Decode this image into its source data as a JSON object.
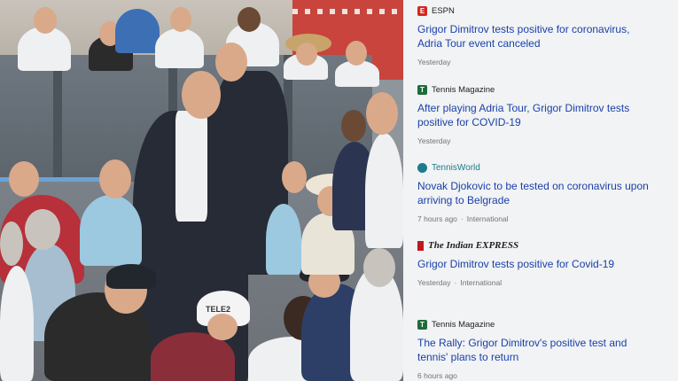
{
  "news": {
    "items": [
      {
        "source": "ESPN",
        "source_logo": "espn-logo-icon",
        "headline": "Grigor Dimitrov tests positive for coronavirus, Adria Tour event canceled",
        "time": "Yesterday",
        "tag": ""
      },
      {
        "source": "Tennis Magazine",
        "source_logo": "tennis-magazine-logo-icon",
        "headline": "After playing Adria Tour, Grigor Dimitrov tests positive for COVID-19",
        "time": "Yesterday",
        "tag": ""
      },
      {
        "source": "TennisWorld",
        "source_logo": "tennisworld-logo-icon",
        "headline": "Novak Djokovic to be tested on coronavirus upon arriving to Belgrade",
        "time": "7 hours ago",
        "tag": "International"
      },
      {
        "source": "The Indian EXPRESS",
        "source_logo": "indian-express-logo-icon",
        "headline": "Grigor Dimitrov tests positive for Covid-19",
        "time": "Yesterday",
        "tag": "International"
      },
      {
        "source": "Tennis Magazine",
        "source_logo": "tennis-magazine-logo-icon",
        "headline": "The Rally: Grigor Dimitrov's positive test and tennis' plans to return",
        "time": "6 hours ago",
        "tag": ""
      }
    ]
  },
  "photo": {
    "cap_text": "TELE2"
  },
  "colors": {
    "panel_bg": "#f1f3f4",
    "headline": "#1a3faa",
    "meta": "#70757a",
    "espn_red": "#d7261e",
    "tennis_magazine_green": "#1d6b3a"
  }
}
